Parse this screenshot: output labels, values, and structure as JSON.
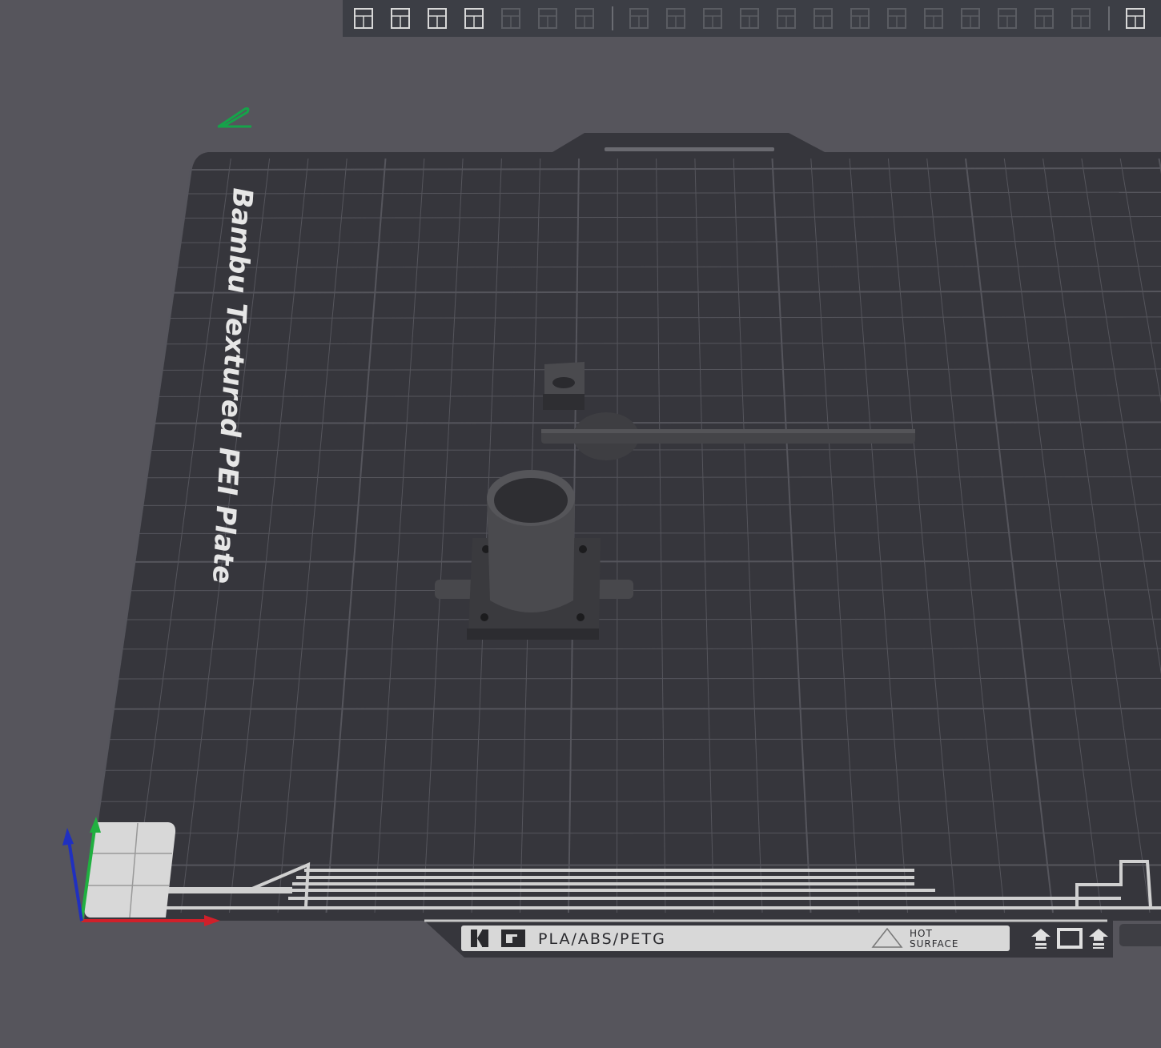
{
  "toolbar": {
    "items": [
      {
        "icon": "add-object-icon",
        "enabled": true
      },
      {
        "icon": "add-plate-icon",
        "enabled": true
      },
      {
        "icon": "auto-orient-icon",
        "enabled": true
      },
      {
        "icon": "arrange-icon",
        "enabled": true
      },
      {
        "icon": "copy-icon",
        "enabled": false
      },
      {
        "icon": "paste-icon",
        "enabled": false
      },
      {
        "icon": "layers-icon",
        "enabled": false
      },
      {
        "separator": true
      },
      {
        "icon": "move-icon",
        "enabled": false
      },
      {
        "icon": "rotate-icon",
        "enabled": false
      },
      {
        "icon": "scale-icon",
        "enabled": false
      },
      {
        "icon": "lay-on-face-icon",
        "enabled": false
      },
      {
        "icon": "cut-icon",
        "enabled": false
      },
      {
        "icon": "mesh-boolean-icon",
        "enabled": false
      },
      {
        "icon": "support-paint-icon",
        "enabled": false
      },
      {
        "icon": "seam-paint-icon",
        "enabled": false
      },
      {
        "icon": "text-icon",
        "enabled": false
      },
      {
        "icon": "color-paint-icon",
        "enabled": false
      },
      {
        "icon": "measure-icon",
        "enabled": false
      },
      {
        "icon": "assembly-icon",
        "enabled": false
      },
      {
        "icon": "brim-ears-icon",
        "enabled": false
      },
      {
        "separator": true
      },
      {
        "icon": "split-objects-icon",
        "enabled": true
      }
    ]
  },
  "plate": {
    "name": "Bambu Textured PEI Plate",
    "strip": {
      "material": "PLA/ABS/PETG",
      "warning_line1": "HOT",
      "warning_line2": "SURFACE"
    }
  },
  "colors": {
    "background": "#56555c",
    "plate": "#36363c",
    "grid": "#55555c",
    "axis_x": "#d0202a",
    "axis_y": "#20b040",
    "axis_z": "#2030c0",
    "edit_icon": "#16a34a"
  }
}
